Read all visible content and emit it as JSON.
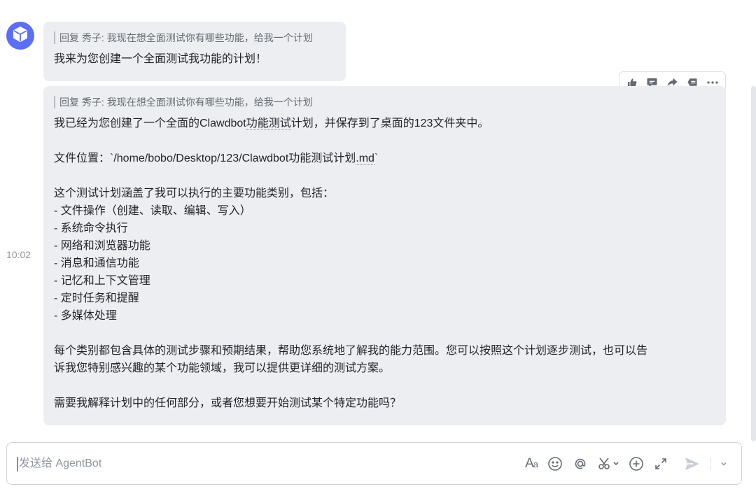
{
  "chat": {
    "assistant_avatar_icon": "cube-icon",
    "timestamp": "10:02",
    "message1": {
      "quote_prefix": "回复 秀子:",
      "quote_text": "我现在想全面测试你有哪些功能，给我一个计划",
      "text": "我来为您创建一个全面测试我功能的计划！"
    },
    "message2": {
      "quote_prefix": "回复 秀子:",
      "quote_text": "我现在想全面测试你有哪些功能，给我一个计划",
      "line1_a": "我已经为您创建了一个全面的Clawdbot",
      "line1_b": "功能测试",
      "line1_c": "计划，并保存到了桌面的123文件夹中。",
      "line2_a": "文件位置：`/home/bobo/Desktop/123/Clawdbot功能测试计划",
      "line2_b": ".md",
      "line2_c": "`",
      "intro": "这个测试计划涵盖了我可以执行的主要功能类别，包括：",
      "items": [
        "- 文件操作（创建、读取、编辑、写入）",
        "- 系统命令执行",
        "- 网络和浏览器功能",
        "- 消息和通信功能",
        "- 记忆和上下文管理",
        "- 定时任务和提醒",
        "- 多媒体处理"
      ],
      "para1": "每个类别都包含具体的测试步骤和预期结果，帮助您系统地了解我的能力范围。您可以按照这个计划逐步测试，也可以告",
      "para2": "诉我您特别感兴趣的某个功能领域，我可以提供更详细的测试方案。",
      "closing": "需要我解释计划中的任何部分，或者您想要开始测试某个特定功能吗？"
    },
    "hover_actions": [
      "thumbs-up-icon",
      "comment-icon",
      "forward-icon",
      "pin-icon",
      "more-icon"
    ]
  },
  "composer": {
    "placeholder": "发送给 AgentBot",
    "tools": [
      "font-format-icon",
      "emoji-icon",
      "mention-icon",
      "scissors-icon",
      "add-icon",
      "expand-icon",
      "send-icon",
      "chevron-down-icon"
    ]
  },
  "colors": {
    "avatar": "#5b6ef5",
    "bubble": "#eceef2",
    "text": "#1f2329",
    "muted": "#646a73"
  }
}
